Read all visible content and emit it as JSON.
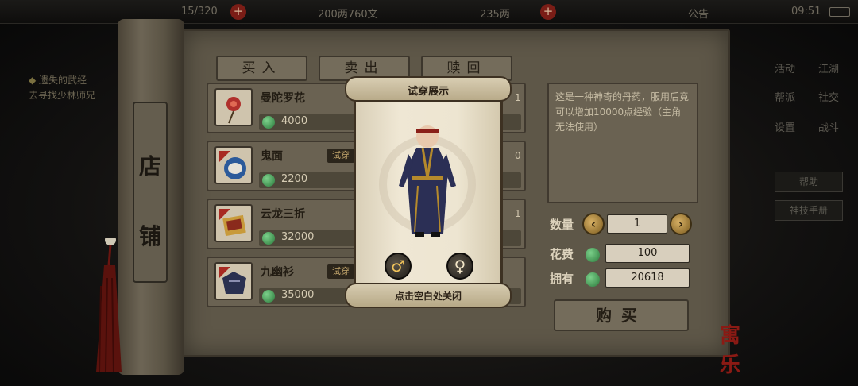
{
  "topbar": {
    "bag_count": "15/320",
    "money": "200两760文",
    "gold": "235两",
    "notice": "公告",
    "time": "09:51"
  },
  "quest": {
    "title": "遗失的武经",
    "desc": "去寻找少林师兄"
  },
  "right_menu": {
    "row1": [
      "活动",
      "江湖"
    ],
    "row2": [
      "帮派",
      "社交"
    ],
    "row3": [
      "设置",
      "战斗"
    ],
    "btn1": "帮助",
    "btn2": "神技手册"
  },
  "shop": {
    "side_tab": [
      "店",
      "铺"
    ],
    "tabs": [
      "买入",
      "卖出",
      "赎回"
    ],
    "try_label": "试穿",
    "items": [
      {
        "name": "曼陀罗花",
        "price": "4000",
        "tail": "1",
        "icon": "red-flower-icon",
        "try": false
      },
      {
        "name": "鬼面",
        "price": "2200",
        "tail": "0",
        "icon": "mask-icon",
        "try": true
      },
      {
        "name": "云龙三折",
        "price": "32000",
        "tail": "1",
        "icon": "manual-icon",
        "try": false
      },
      {
        "name": "九幽衫",
        "price": "35000",
        "tail": "",
        "icon": "robe-icon",
        "try": true
      }
    ]
  },
  "detail": {
    "description": "这是一种神奇的丹药，服用后竟可以增加10000点经验（主角无法使用）",
    "quantity_label": "数量",
    "quantity": "1",
    "cost_label": "花费",
    "cost": "100",
    "own_label": "拥有",
    "own": "20618",
    "buy_label": "购买",
    "stamp": "寓乐"
  },
  "popup": {
    "title": "试穿展示",
    "close_hint": "点击空白处关闭",
    "male_symbol": "♂",
    "female_symbol": "♀"
  }
}
